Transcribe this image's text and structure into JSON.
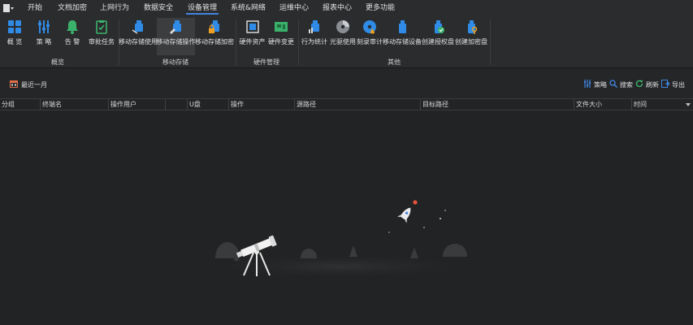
{
  "menu": {
    "items": [
      "开始",
      "文档加密",
      "上网行为",
      "数据安全",
      "设备管理",
      "系统&网络",
      "运维中心",
      "报表中心",
      "更多功能"
    ],
    "active_index": 4
  },
  "ribbon": {
    "buttons": [
      {
        "label": "概 览",
        "icon": "grid-icon"
      },
      {
        "label": "策 略",
        "icon": "sliders-icon"
      },
      {
        "label": "告 警",
        "icon": "bell-icon"
      },
      {
        "label": "审批任务",
        "icon": "clipboard-check-icon"
      },
      {
        "label": "移动存储使用",
        "icon": "usb-icon"
      },
      {
        "label": "移动存储操作",
        "icon": "usb-edit-icon"
      },
      {
        "label": "移动存储加密",
        "icon": "usb-lock-icon"
      },
      {
        "label": "硬件资产",
        "icon": "cpu-icon"
      },
      {
        "label": "硬件变更",
        "icon": "board-icon"
      },
      {
        "label": "行为统计",
        "icon": "usb-stats-icon"
      },
      {
        "label": "光驱使用",
        "icon": "disc-icon"
      },
      {
        "label": "刻录审计",
        "icon": "burn-disc-icon"
      },
      {
        "label": "移动存储设备",
        "icon": "usb-device-icon"
      },
      {
        "label": "创建授权盘",
        "icon": "usb-authorize-icon"
      },
      {
        "label": "创建加密盘",
        "icon": "usb-key-icon"
      }
    ],
    "selected_index": 5,
    "groups": [
      "概览",
      "移动存储",
      "硬件管理",
      "其他"
    ]
  },
  "toolbar": {
    "date_filter": "最近一月",
    "actions": [
      {
        "label": "策略",
        "icon": "sliders-icon"
      },
      {
        "label": "搜索",
        "icon": "search-icon"
      },
      {
        "label": "刷新",
        "icon": "refresh-icon"
      },
      {
        "label": "导出",
        "icon": "export-icon"
      }
    ]
  },
  "table": {
    "columns": [
      "分组",
      "终端名",
      "操作用户",
      "",
      "U盘",
      "操作",
      "源路径",
      "目标路径",
      "文件大小",
      "时间"
    ],
    "rows": []
  },
  "colors": {
    "accent": "#3f86e0",
    "usb_blue": "#2f8be6",
    "green": "#3bb26b",
    "orange": "#f0a020",
    "background": "#222324",
    "ribbon": "#2b2c2e"
  }
}
